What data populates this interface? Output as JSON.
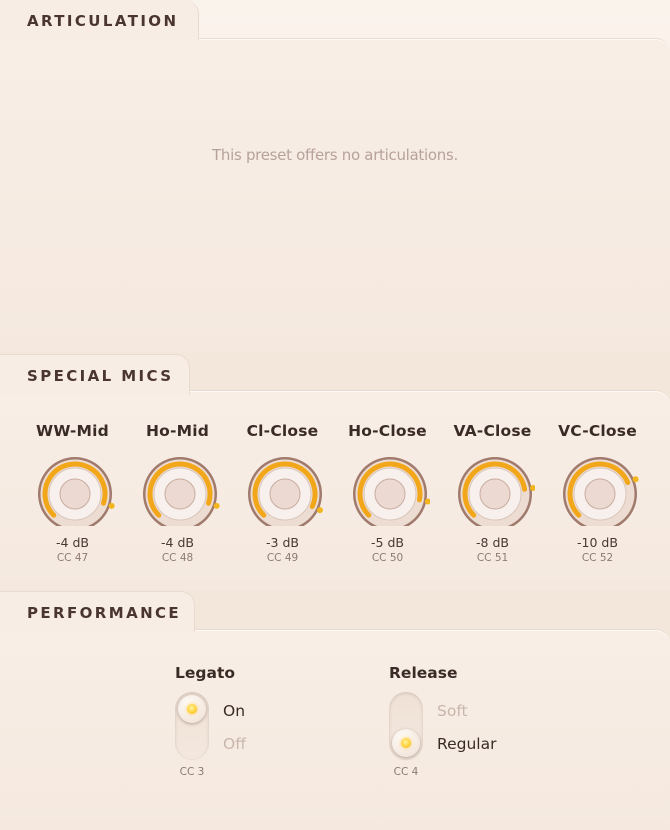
{
  "articulation": {
    "title": "ARTICULATION",
    "empty_message": "This preset offers no articulations."
  },
  "special_mics": {
    "title": "SPECIAL MICS",
    "mics": [
      {
        "name": "WW-Mid",
        "level": "-4 dB",
        "cc": "CC 47",
        "db": -4
      },
      {
        "name": "Ho-Mid",
        "level": "-4 dB",
        "cc": "CC 48",
        "db": -4
      },
      {
        "name": "Cl-Close",
        "level": "-3 dB",
        "cc": "CC 49",
        "db": -3
      },
      {
        "name": "Ho-Close",
        "level": "-5 dB",
        "cc": "CC 50",
        "db": -5
      },
      {
        "name": "VA-Close",
        "level": "-8 dB",
        "cc": "CC 51",
        "db": -8
      },
      {
        "name": "VC-Close",
        "level": "-10 dB",
        "cc": "CC 52",
        "db": -10
      }
    ],
    "accent_color": "#f2a71b"
  },
  "performance": {
    "title": "PERFORMANCE",
    "legato": {
      "title": "Legato",
      "options": [
        "On",
        "Off"
      ],
      "selected": "On",
      "cc": "CC 3"
    },
    "release": {
      "title": "Release",
      "options": [
        "Soft",
        "Regular"
      ],
      "selected": "Regular",
      "cc": "CC 4"
    }
  }
}
